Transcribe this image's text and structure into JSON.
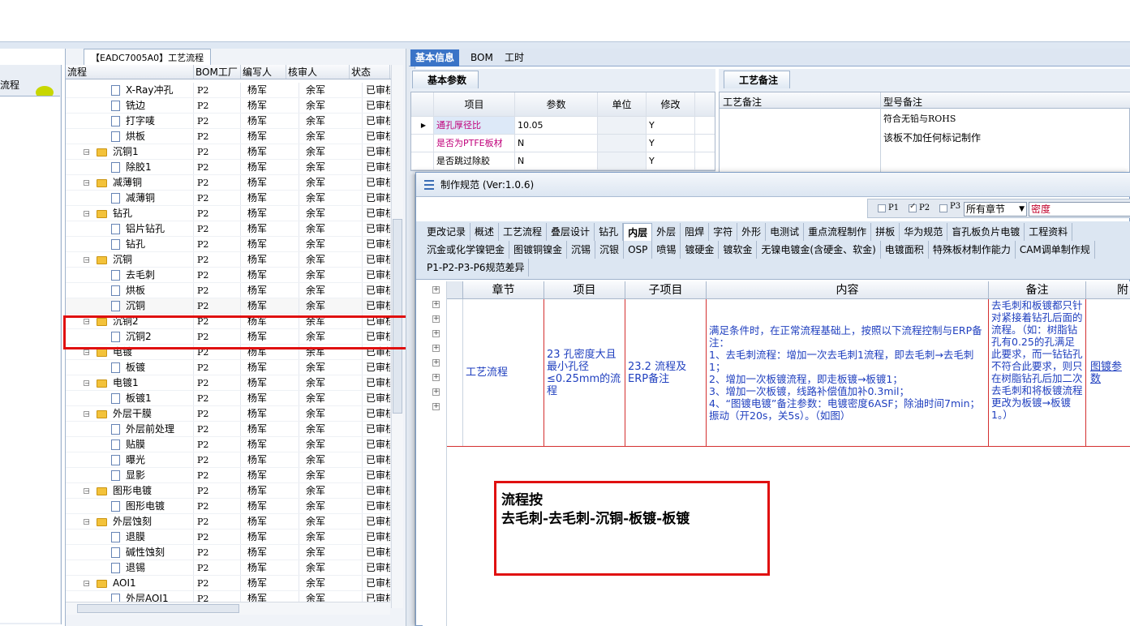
{
  "left_panel": {
    "item_label": "流程"
  },
  "tree": {
    "tab_title": "【EADC7005A0】工艺流程",
    "columns": [
      "流程",
      "BOM工厂",
      "编写人",
      "核审人",
      "状态"
    ],
    "rows": [
      {
        "type": "doc",
        "label": "X-Ray冲孔",
        "bom": "P2",
        "writer": "杨军",
        "reviewer": "余军",
        "status": "已审核"
      },
      {
        "type": "doc",
        "label": "铣边",
        "bom": "P2",
        "writer": "杨军",
        "reviewer": "余军",
        "status": "已审核"
      },
      {
        "type": "doc",
        "label": "打字唛",
        "bom": "P2",
        "writer": "杨军",
        "reviewer": "余军",
        "status": "已审核"
      },
      {
        "type": "doc",
        "label": "烘板",
        "bom": "P2",
        "writer": "杨军",
        "reviewer": "余军",
        "status": "已审核"
      },
      {
        "type": "folder",
        "label": "沉铜1",
        "bom": "P2",
        "writer": "杨军",
        "reviewer": "余军",
        "status": "已审核"
      },
      {
        "type": "doc",
        "label": "除胶1",
        "bom": "P2",
        "writer": "杨军",
        "reviewer": "余军",
        "status": "已审核"
      },
      {
        "type": "folder",
        "label": "减薄铜",
        "bom": "P2",
        "writer": "杨军",
        "reviewer": "余军",
        "status": "已审核"
      },
      {
        "type": "doc",
        "label": "减薄铜",
        "bom": "P2",
        "writer": "杨军",
        "reviewer": "余军",
        "status": "已审核"
      },
      {
        "type": "folder",
        "label": "钻孔",
        "bom": "P2",
        "writer": "杨军",
        "reviewer": "余军",
        "status": "已审核"
      },
      {
        "type": "doc",
        "label": "铝片钻孔",
        "bom": "P2",
        "writer": "杨军",
        "reviewer": "余军",
        "status": "已审核"
      },
      {
        "type": "doc",
        "label": "钻孔",
        "bom": "P2",
        "writer": "杨军",
        "reviewer": "余军",
        "status": "已审核"
      },
      {
        "type": "folder",
        "label": "沉铜",
        "bom": "P2",
        "writer": "杨军",
        "reviewer": "余军",
        "status": "已审核"
      },
      {
        "type": "doc",
        "label": "去毛刺",
        "bom": "P2",
        "writer": "杨军",
        "reviewer": "余军",
        "status": "已审核"
      },
      {
        "type": "doc",
        "label": "烘板",
        "bom": "P2",
        "writer": "杨军",
        "reviewer": "余军",
        "status": "已审核"
      },
      {
        "type": "doc",
        "label": "沉铜",
        "bom": "P2",
        "writer": "杨军",
        "reviewer": "余军",
        "status": "已审核"
      },
      {
        "type": "folder",
        "label": "沉铜2",
        "bom": "P2",
        "writer": "杨军",
        "reviewer": "余军",
        "status": "已审核"
      },
      {
        "type": "doc",
        "label": "沉铜2",
        "bom": "P2",
        "writer": "杨军",
        "reviewer": "余军",
        "status": "已审核"
      },
      {
        "type": "folder",
        "label": "电镀",
        "bom": "P2",
        "writer": "杨军",
        "reviewer": "余军",
        "status": "已审核"
      },
      {
        "type": "doc",
        "label": "板镀",
        "bom": "P2",
        "writer": "杨军",
        "reviewer": "余军",
        "status": "已审核"
      },
      {
        "type": "folder",
        "label": "电镀1",
        "bom": "P2",
        "writer": "杨军",
        "reviewer": "余军",
        "status": "已审核"
      },
      {
        "type": "doc",
        "label": "板镀1",
        "bom": "P2",
        "writer": "杨军",
        "reviewer": "余军",
        "status": "已审核"
      },
      {
        "type": "folder",
        "label": "外层干膜",
        "bom": "P2",
        "writer": "杨军",
        "reviewer": "余军",
        "status": "已审核"
      },
      {
        "type": "doc",
        "label": "外层前处理",
        "bom": "P2",
        "writer": "杨军",
        "reviewer": "余军",
        "status": "已审核"
      },
      {
        "type": "doc",
        "label": "贴膜",
        "bom": "P2",
        "writer": "杨军",
        "reviewer": "余军",
        "status": "已审核"
      },
      {
        "type": "doc",
        "label": "曝光",
        "bom": "P2",
        "writer": "杨军",
        "reviewer": "余军",
        "status": "已审核"
      },
      {
        "type": "doc",
        "label": "显影",
        "bom": "P2",
        "writer": "杨军",
        "reviewer": "余军",
        "status": "已审核"
      },
      {
        "type": "folder",
        "label": "图形电镀",
        "bom": "P2",
        "writer": "杨军",
        "reviewer": "余军",
        "status": "已审核"
      },
      {
        "type": "doc",
        "label": "图形电镀",
        "bom": "P2",
        "writer": "杨军",
        "reviewer": "余军",
        "status": "已审核"
      },
      {
        "type": "folder",
        "label": "外层蚀刻",
        "bom": "P2",
        "writer": "杨军",
        "reviewer": "余军",
        "status": "已审核"
      },
      {
        "type": "doc",
        "label": "退膜",
        "bom": "P2",
        "writer": "杨军",
        "reviewer": "余军",
        "status": "已审核"
      },
      {
        "type": "doc",
        "label": "碱性蚀刻",
        "bom": "P2",
        "writer": "杨军",
        "reviewer": "余军",
        "status": "已审核"
      },
      {
        "type": "doc",
        "label": "退锡",
        "bom": "P2",
        "writer": "杨军",
        "reviewer": "余军",
        "status": "已审核"
      },
      {
        "type": "folder",
        "label": "AOI1",
        "bom": "P2",
        "writer": "杨军",
        "reviewer": "余军",
        "status": "已审核"
      },
      {
        "type": "doc",
        "label": "外层AOI1",
        "bom": "P2",
        "writer": "杨军",
        "reviewer": "余军",
        "status": "已审核"
      }
    ]
  },
  "top_tabs": [
    "基本信息",
    "BOM",
    "工时"
  ],
  "basic": {
    "tab": "基本参数",
    "columns": [
      "项目",
      "参数",
      "单位",
      "修改"
    ],
    "rows": [
      {
        "item": "通孔厚径比",
        "value": "10.05",
        "unit": "",
        "mod": "Y"
      },
      {
        "item": "是否为PTFE板材",
        "value": "N",
        "unit": "",
        "mod": "Y"
      },
      {
        "item": "是否跳过除胶",
        "value": "N",
        "unit": "",
        "mod": "Y"
      }
    ]
  },
  "notes": {
    "tab": "工艺备注",
    "col1": "工艺备注",
    "col2": "型号备注",
    "line1": "符合无铅与ROHS",
    "line2": "该板不加任何标记制作"
  },
  "popup": {
    "title": "制作规范 (Ver:1.0.6)",
    "filters": {
      "p1": "P1",
      "p2": "P2",
      "p3": "P3",
      "chapter": "所有章节",
      "search": "密度"
    },
    "tabs_row1": [
      "更改记录",
      "概述",
      "工艺流程",
      "叠层设计",
      "钻孔",
      "内层",
      "外层",
      "阻焊",
      "字符",
      "外形",
      "电测试",
      "重点流程制作",
      "拼板",
      "华为规范",
      "盲孔板负片电镀",
      "工程资料"
    ],
    "tabs_row2": [
      "沉金或化学镍钯金",
      "图镀铜镍金",
      "沉锡",
      "沉银",
      "OSP",
      "喷锡",
      "镀硬金",
      "镀软金",
      "无镍电镀金(含硬金、软金)",
      "电镀面积",
      "特殊板材制作能力",
      "CAM调单制作规"
    ],
    "tabs_row3": [
      "P1-P2-P3-P6规范差异"
    ],
    "grid_columns": [
      "章节",
      "项目",
      "子项目",
      "内容",
      "备注",
      "附"
    ],
    "grid_row": {
      "chapter": "工艺流程",
      "item": "23 孔密度大且最小孔径≤0.25mm的流程",
      "subitem": "23.2 流程及ERP备注",
      "content": "满足条件时，在正常流程基础上，按照以下流程控制与ERP备注：\n1、去毛刺流程：增加一次去毛刺1流程，即去毛刺→去毛刺1；\n2、增加一次板镀流程，即走板镀→板镀1；\n3、增加一次板镀，线路补偿值加补0.3mil；\n4、“图镀电镀”备注参数：电镀密度6ASF；除油时间7min；振动（开20s，关5s）。（如图）",
      "note": "去毛刺和板镀都只针对紧接着钻孔后面的流程。（如：树脂钻孔有0.25的孔满足此要求，而一钻钻孔不符合此要求，则只在树脂钻孔后加二次去毛刺和将板镀流程更改为板镀→板镀1。）",
      "attach": "图镀参数"
    }
  },
  "callout": {
    "line1": "流程按",
    "line2": "去毛刺-去毛刺-沉铜-板镀-板镀"
  },
  "colors": {
    "accent": "#3a74c7",
    "highlight_red": "#e01010",
    "link_blue": "#1f3fbf"
  }
}
